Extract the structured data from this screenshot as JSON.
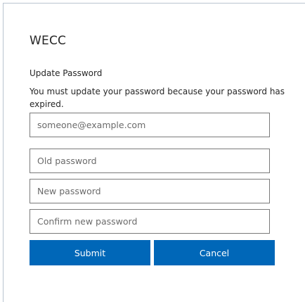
{
  "brand": {
    "name": "WECC"
  },
  "form": {
    "heading": "Update Password",
    "message": "You must update your password because your password has expired.",
    "email_placeholder": "someone@example.com",
    "old_password_placeholder": "Old password",
    "new_password_placeholder": "New password",
    "confirm_password_placeholder": "Confirm new password"
  },
  "buttons": {
    "submit": "Submit",
    "cancel": "Cancel"
  },
  "colors": {
    "button_bg": "#0067b8",
    "button_text": "#ffffff",
    "field_border": "#7a7a7a"
  }
}
